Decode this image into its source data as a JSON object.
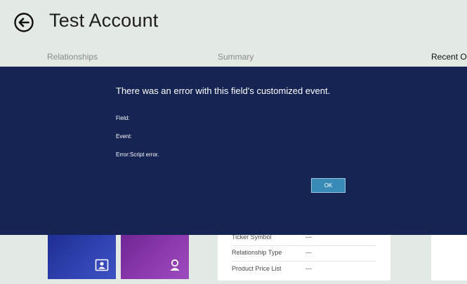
{
  "header": {
    "title": "Test Account",
    "back_icon": "back-arrow-icon"
  },
  "sections": [
    {
      "label": "Relationships"
    },
    {
      "label": "Summary"
    },
    {
      "label": "Recent Op"
    }
  ],
  "tiles": [
    {
      "icon": "contact-card-icon",
      "color": "#3244b3"
    },
    {
      "icon": "person-icon",
      "color": "#8e3bb0"
    }
  ],
  "summary_fields": [
    {
      "label": "Ticker Symbol",
      "value": "---"
    },
    {
      "label": "Relationship Type",
      "value": "---"
    },
    {
      "label": "Product Price List",
      "value": "---"
    }
  ],
  "dialog": {
    "title": "There was an error with this field's customized event.",
    "field_line": "Field:",
    "event_line": "Event:",
    "error_line": "Error:Script error.",
    "ok_label": "OK",
    "background": "#162454",
    "button_color": "#3a8ab8"
  }
}
